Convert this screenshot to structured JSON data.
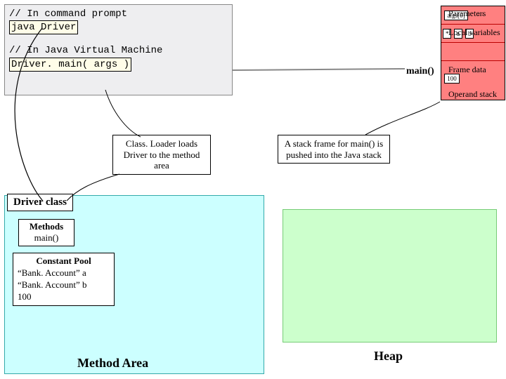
{
  "code": {
    "comment1": "// In command prompt",
    "line1": "java Driver",
    "comment2": "// In Java Virtual Machine",
    "line2": "Driver. main( args )"
  },
  "stack": {
    "args0": "args[0]",
    "dots": ". .",
    "asterisk": "*",
    "a": "a",
    "b": "b",
    "val100": "100",
    "main_label": "main()"
  },
  "labels": {
    "parameters": "Parameters",
    "local_vars": "Local variables",
    "frame_data": "Frame data",
    "operand_stack": "Operand stack"
  },
  "callouts": {
    "classloader": "Class. Loader loads Driver to the method area",
    "stackframe": "A stack frame for main() is pushed into the Java stack"
  },
  "method_area": {
    "driver_class": "Driver class",
    "methods_title": "Methods",
    "methods_item": "main()",
    "const_title": "Constant Pool",
    "const_a": "“Bank. Account” a",
    "const_b": "“Bank. Account” b",
    "const_100": "100",
    "label": "Method Area"
  },
  "heap": {
    "label": "Heap"
  }
}
